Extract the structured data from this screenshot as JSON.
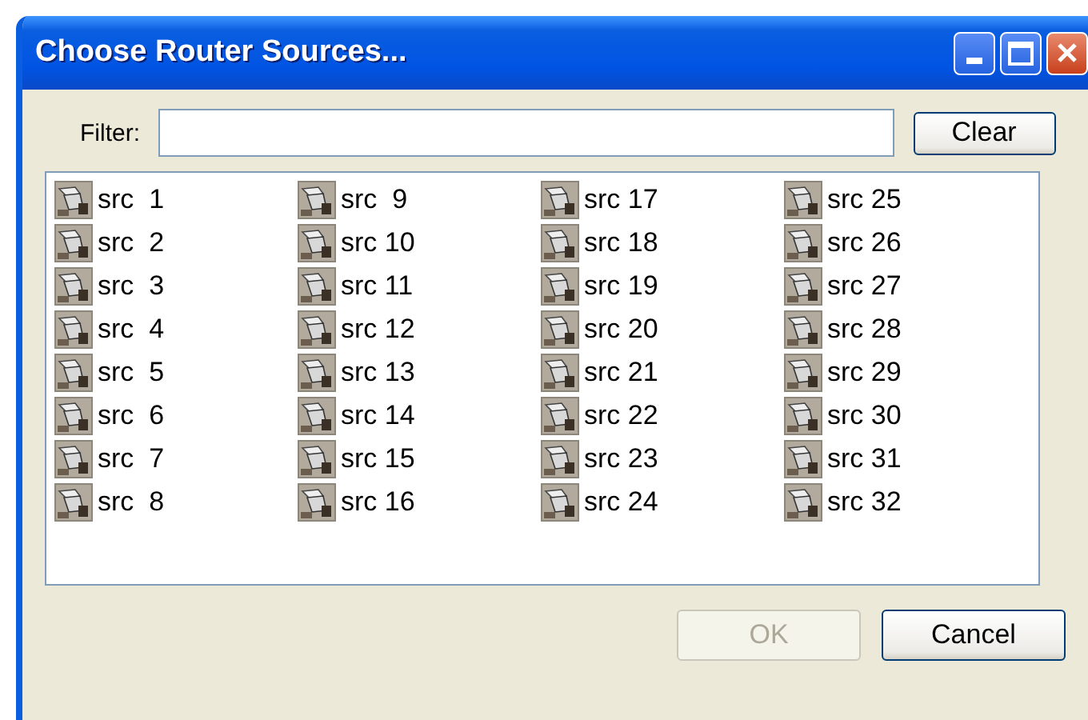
{
  "window": {
    "title": "Choose Router Sources..."
  },
  "filter": {
    "label": "Filter:"
  },
  "clear_button": {
    "label": "Clear"
  },
  "sources": [
    {
      "label": "src  1"
    },
    {
      "label": "src  2"
    },
    {
      "label": "src  3"
    },
    {
      "label": "src  4"
    },
    {
      "label": "src  5"
    },
    {
      "label": "src  6"
    },
    {
      "label": "src  7"
    },
    {
      "label": "src  8"
    },
    {
      "label": "src  9"
    },
    {
      "label": "src 10"
    },
    {
      "label": "src 11"
    },
    {
      "label": "src 12"
    },
    {
      "label": "src 13"
    },
    {
      "label": "src 14"
    },
    {
      "label": "src 15"
    },
    {
      "label": "src 16"
    },
    {
      "label": "src 17"
    },
    {
      "label": "src 18"
    },
    {
      "label": "src 19"
    },
    {
      "label": "src 20"
    },
    {
      "label": "src 21"
    },
    {
      "label": "src 22"
    },
    {
      "label": "src 23"
    },
    {
      "label": "src 24"
    },
    {
      "label": "src 25"
    },
    {
      "label": "src 26"
    },
    {
      "label": "src 27"
    },
    {
      "label": "src 28"
    },
    {
      "label": "src 29"
    },
    {
      "label": "src 30"
    },
    {
      "label": "src 31"
    },
    {
      "label": "src 32"
    }
  ],
  "buttons": [
    {
      "label": "OK",
      "disabled": true
    },
    {
      "label": "Cancel",
      "disabled": false
    }
  ]
}
